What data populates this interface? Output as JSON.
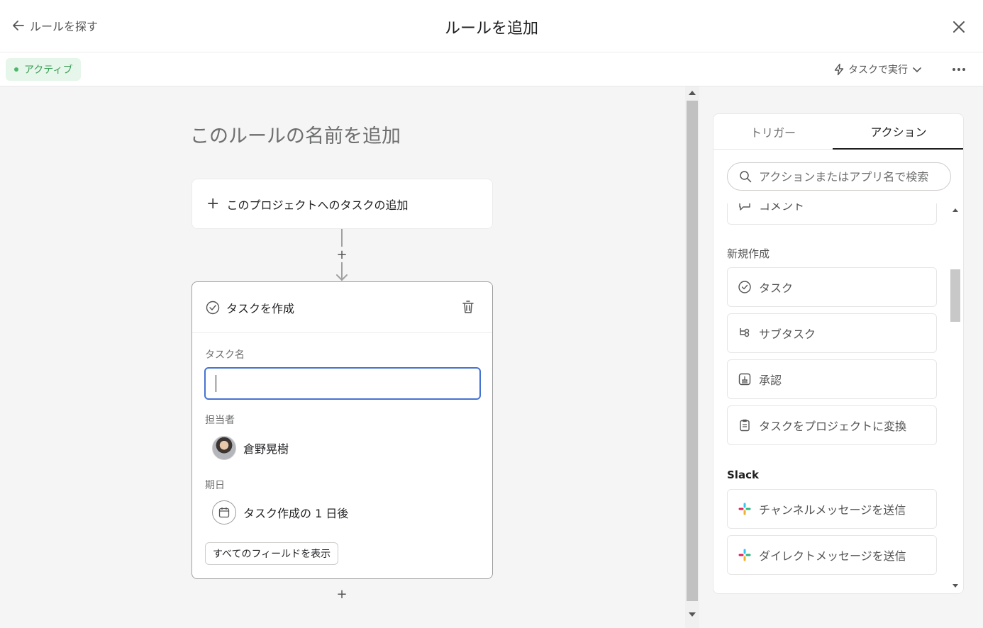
{
  "header": {
    "back_label": "ルールを探す",
    "title": "ルールを追加"
  },
  "subbar": {
    "status": "アクティブ",
    "run_label": "タスクで実行"
  },
  "canvas": {
    "rule_name_placeholder": "このルールの名前を追加",
    "trigger_label": "このプロジェクトへのタスクの追加",
    "action": {
      "title": "タスクを作成",
      "task_name_label": "タスク名",
      "task_name_value": "",
      "assignee_label": "担当者",
      "assignee_name": "倉野晃樹",
      "due_label": "期日",
      "due_value": "タスク作成の 1 日後",
      "show_all_label": "すべてのフィールドを表示"
    }
  },
  "panel": {
    "tabs": [
      {
        "label": "トリガー",
        "active": false
      },
      {
        "label": "アクション",
        "active": true
      }
    ],
    "search_placeholder": "アクションまたはアプリ名で検索",
    "partial_item": "コメント",
    "groups": [
      {
        "label": "新規作成",
        "items": [
          {
            "label": "タスク",
            "icon": "check-circle-plus-icon"
          },
          {
            "label": "サブタスク",
            "icon": "subtask-icon"
          },
          {
            "label": "承認",
            "icon": "approval-icon"
          },
          {
            "label": "タスクをプロジェクトに変換",
            "icon": "convert-clipboard-icon"
          }
        ]
      },
      {
        "label": "Slack",
        "items": [
          {
            "label": "チャンネルメッセージを送信",
            "icon": "slack-icon"
          },
          {
            "label": "ダイレクトメッセージを送信",
            "icon": "slack-icon"
          }
        ]
      }
    ]
  },
  "colors": {
    "accent_blue": "#4573d2",
    "status_green": "#3f9d59",
    "status_bg": "#e6f6ea",
    "canvas_bg": "#f6f5f5"
  }
}
